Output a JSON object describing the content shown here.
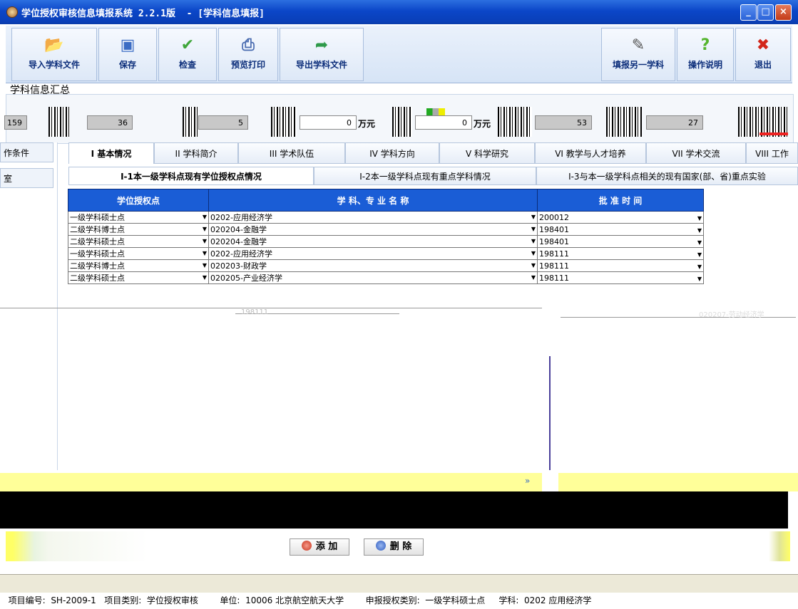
{
  "window": {
    "title": "学位授权审核信息填报系统 2.2.1版  - [学科信息填报]",
    "min": "_",
    "max": "□",
    "close": "×"
  },
  "toolbar": {
    "import_label": "导入学科文件",
    "save_label": "保存",
    "check_label": "检查",
    "preview_label": "预览打印",
    "export_label": "导出学科文件",
    "fill_other_label": "填报另一学科",
    "help_label": "操作说明",
    "exit_label": "退出"
  },
  "icons": {
    "import": "folder-icon",
    "save": "floppy-disk-icon",
    "check": "checkmark-icon",
    "preview": "printer-icon",
    "export": "export-folder-icon",
    "fill_other": "pencil-icon",
    "help": "question-mark-icon",
    "exit": "x-icon"
  },
  "summary": {
    "label": "学科信息汇总",
    "values": [
      "159",
      "36",
      "5",
      "0",
      "0",
      "53",
      "27"
    ],
    "unit": "万元",
    "unit2": "万元"
  },
  "left_panel": {
    "items": [
      "作条件",
      "室"
    ]
  },
  "tabs": [
    "I 基本情况",
    "II 学科简介",
    "III 学术队伍",
    "IV 学科方向",
    "V 科学研究",
    "VI 教学与人才培养",
    "VII 学术交流",
    "VIII 工作"
  ],
  "subtabs": [
    "I-1本一级学科点现有学位授权点情况",
    "I-2本一级学科点现有重点学科情况",
    "I-3与本一级学科点相关的现有国家(部、省)重点实验"
  ],
  "table": {
    "headers": [
      "学位授权点",
      "学 科、专 业 名 称",
      "批 准 时 间"
    ],
    "rows": [
      [
        "一级学科硕士点",
        "0202-应用经济学",
        "200012"
      ],
      [
        "二级学科博士点",
        "020204-金融学",
        "198401"
      ],
      [
        "二级学科硕士点",
        "020204-金融学",
        "198401"
      ],
      [
        "一级学科硕士点",
        "0202-应用经济学",
        "198111"
      ],
      [
        "二级学科博士点",
        "020203-财政学",
        "198111"
      ],
      [
        "二级学科硕士点",
        "020205-产业经济学",
        "198111"
      ]
    ]
  },
  "glitch": {
    "time_fragment": "198111",
    "code_fragment": "020207-劳动经济学"
  },
  "buttons": {
    "add": "添 加",
    "delete": "删 除"
  },
  "status": {
    "text": "项目编号:  SH-2009-1   项目类别:  学位授权审核        单位:  10006 北京航空航天大学        申报授权类别:  一级学科硕士点     学科:  0202 应用经济学"
  },
  "colors": {
    "title_bar": "#0b46c8",
    "table_header": "#1a5dd6",
    "hint_bg": "#ffff99"
  }
}
